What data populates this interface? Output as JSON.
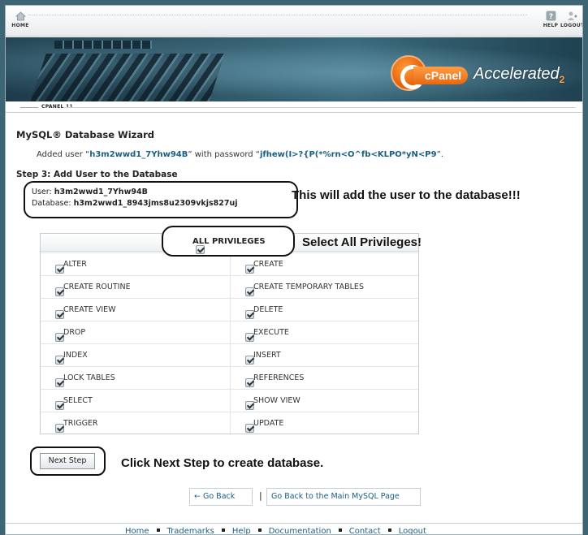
{
  "topnav": {
    "home_label": "HOME",
    "help_label": "HELP",
    "logout_label": "LOGOUT"
  },
  "brand": {
    "logo_text": "cPanel",
    "accelerated": "Accelerated",
    "version_sub": "2",
    "version_bar": "CPANEL 11"
  },
  "page": {
    "title": "MySQL® Database Wizard",
    "added_prefix": "Added user “",
    "added_user": "h3m2wwd1_7Yhw94B",
    "added_mid": "” with password “",
    "added_password": "jfhew(I>?{P(*%rn<O^fb<KLPO*yN<P9",
    "added_suffix": "”.",
    "step_title": "Step 3: Add User to the Database",
    "user_label": "User:",
    "user_value": "h3m2wwd1_7Yhw94B",
    "db_label": "Database:",
    "db_value": "h3m2wwd1_8943jms8u2309vkjs827uj"
  },
  "annotations": {
    "db_note": "This will add the user to the database!!!",
    "all_note": "Select All Privileges!",
    "next_note": "Click Next Step to create database."
  },
  "privileges": {
    "all_label": "ALL PRIVILEGES",
    "rows": [
      [
        "ALTER",
        "CREATE"
      ],
      [
        "CREATE ROUTINE",
        "CREATE TEMPORARY TABLES"
      ],
      [
        "CREATE VIEW",
        "DELETE"
      ],
      [
        "DROP",
        "EXECUTE"
      ],
      [
        "INDEX",
        "INSERT"
      ],
      [
        "LOCK TABLES",
        "REFERENCES"
      ],
      [
        "SELECT",
        "SHOW VIEW"
      ],
      [
        "TRIGGER",
        "UPDATE"
      ]
    ]
  },
  "actions": {
    "next_step": "Next Step",
    "go_back": "← Go Back",
    "separator": "|",
    "main_mysql": "Go Back to the Main MySQL Page"
  },
  "footer": {
    "links": [
      "Home",
      "Trademarks",
      "Help",
      "Documentation",
      "Contact",
      "Logout"
    ]
  }
}
